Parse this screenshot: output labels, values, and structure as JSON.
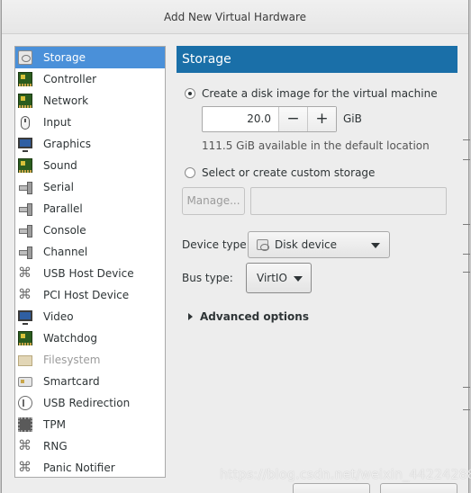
{
  "window": {
    "title": "Add New Virtual Hardware"
  },
  "hardware_list": [
    {
      "label": "Storage",
      "icon": "storage-icon",
      "selected": true
    },
    {
      "label": "Controller",
      "icon": "controller-icon"
    },
    {
      "label": "Network",
      "icon": "network-icon"
    },
    {
      "label": "Input",
      "icon": "mouse-icon"
    },
    {
      "label": "Graphics",
      "icon": "graphics-icon"
    },
    {
      "label": "Sound",
      "icon": "sound-icon"
    },
    {
      "label": "Serial",
      "icon": "serial-icon"
    },
    {
      "label": "Parallel",
      "icon": "parallel-icon"
    },
    {
      "label": "Console",
      "icon": "console-icon"
    },
    {
      "label": "Channel",
      "icon": "channel-icon"
    },
    {
      "label": "USB Host Device",
      "icon": "usb-icon"
    },
    {
      "label": "PCI Host Device",
      "icon": "pci-icon"
    },
    {
      "label": "Video",
      "icon": "video-icon"
    },
    {
      "label": "Watchdog",
      "icon": "watchdog-icon"
    },
    {
      "label": "Filesystem",
      "icon": "folder-icon",
      "disabled": true
    },
    {
      "label": "Smartcard",
      "icon": "smartcard-icon"
    },
    {
      "label": "USB Redirection",
      "icon": "usb-redirection-icon"
    },
    {
      "label": "TPM",
      "icon": "chip-icon"
    },
    {
      "label": "RNG",
      "icon": "rng-icon"
    },
    {
      "label": "Panic Notifier",
      "icon": "panic-icon"
    }
  ],
  "storage": {
    "header": "Storage",
    "create_disk_label": "Create a disk image for the virtual machine",
    "disk_size_value": "20.0",
    "minus": "−",
    "plus": "+",
    "unit": "GiB",
    "available_text": "111.5 GiB available in the default location",
    "custom_storage_label": "Select or create custom storage",
    "manage_label": "Manage...",
    "custom_path_value": "",
    "device_type_label": "Device type:",
    "device_type_value": "Disk device",
    "bus_type_label": "Bus type:",
    "bus_type_value": "VirtIO",
    "advanced_label": "Advanced options"
  },
  "watermark": "https://blog.csdn.net/weixin_44224288"
}
